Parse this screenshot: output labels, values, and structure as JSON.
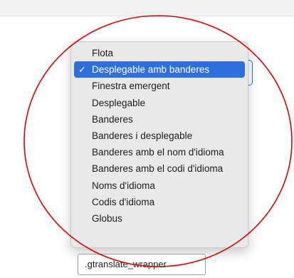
{
  "dropdown": {
    "selected_index": 1,
    "items": [
      {
        "label": "Flota"
      },
      {
        "label": "Desplegable amb banderes"
      },
      {
        "label": "Finestra emergent"
      },
      {
        "label": "Desplegable"
      },
      {
        "label": "Banderes"
      },
      {
        "label": "Banderes i desplegable"
      },
      {
        "label": "Banderes amb el nom d'idioma"
      },
      {
        "label": "Banderes amb el codi d'idioma"
      },
      {
        "label": "Noms d'idioma"
      },
      {
        "label": "Codis d'idioma"
      },
      {
        "label": "Globus"
      }
    ],
    "check_glyph": "✓"
  },
  "wrapper_field": {
    "value": ".gtranslate_wrapper"
  },
  "colors": {
    "selection": "#2f6fdb",
    "annotation_circle": "#e00000",
    "menu_background": "#e9e9e9"
  }
}
